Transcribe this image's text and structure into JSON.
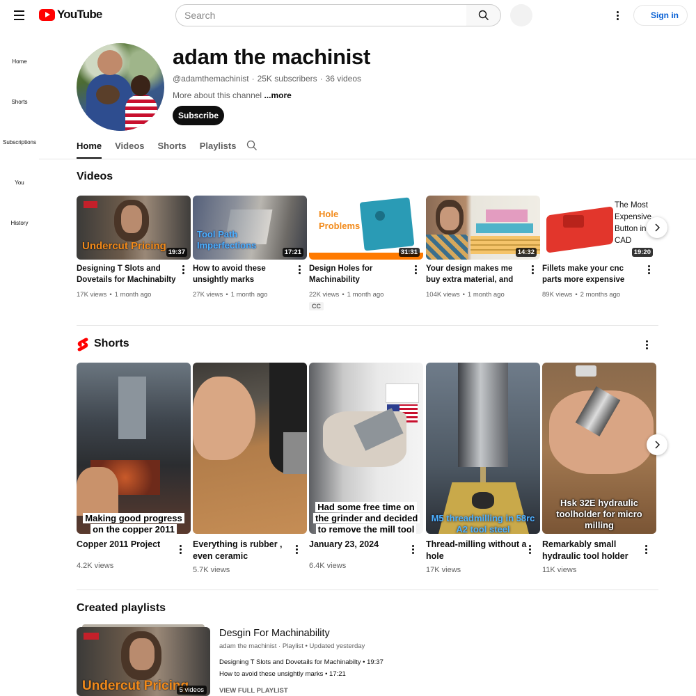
{
  "topbar": {
    "logo_text": "YouTube",
    "search_placeholder": "Search",
    "signin_label": "Sign in"
  },
  "leftnav": [
    "Home",
    "Shorts",
    "Subscriptions",
    "You",
    "History"
  ],
  "channel": {
    "name": "adam the machinist",
    "handle": "@adamthemachinist",
    "subscribers": "25K subscribers",
    "videos_count": "36 videos",
    "about": "More about this channel",
    "more": "...more",
    "subscribe_label": "Subscribe"
  },
  "tabs": [
    "Home",
    "Videos",
    "Shorts",
    "Playlists"
  ],
  "videos_section": {
    "title": "Videos",
    "items": [
      {
        "title": "Designing T Slots and Dovetails for Machinabilty",
        "views": "17K views",
        "age": "1 month ago",
        "duration": "19:37",
        "thumb_text": "Undercut Pricing"
      },
      {
        "title": "How to avoid these unsightly marks",
        "views": "27K views",
        "age": "1 month ago",
        "duration": "17:21",
        "thumb_text": "Tool Path Imperfections"
      },
      {
        "title": "Design Holes for Machinability",
        "views": "22K views",
        "age": "1 month ago",
        "duration": "31:31",
        "thumb_text": "Hole Problems",
        "badge": "CC"
      },
      {
        "title": "Your design makes me buy extra material, and then you...",
        "views": "104K views",
        "age": "1 month ago",
        "duration": "14:32",
        "thumb_text": ""
      },
      {
        "title": "Fillets make your cnc parts more expensive",
        "views": "89K views",
        "age": "2 months ago",
        "duration": "19:20",
        "thumb_text": "The Most Expensive Button in CAD"
      }
    ]
  },
  "shorts_section": {
    "title": "Shorts",
    "items": [
      {
        "title": "Copper 2011 Project",
        "views": "4.2K views",
        "caption": "Making good progress on the copper 2011"
      },
      {
        "title": "Everything is rubber , even ceramic",
        "views": "5.7K views",
        "caption": ""
      },
      {
        "title": "January 23, 2024",
        "views": "6.4K views",
        "caption": "Had some free time on the grinder and decided to remove the mill tool"
      },
      {
        "title": "Thread-milling without a hole",
        "views": "17K views",
        "caption": "M5 threadmilling in 58rc A2 tool steel"
      },
      {
        "title": "Remarkably small hydraulic tool holder",
        "views": "11K views",
        "caption": "Hsk 32E hydraulic toolholder for micro milling"
      }
    ]
  },
  "playlists_section": {
    "title": "Created playlists",
    "playlist": {
      "title": "Desgin For Machinability",
      "owner": "adam the machinist",
      "kind": "Playlist",
      "updated": "Updated yesterday",
      "count": "5 videos",
      "items": [
        {
          "title": "Designing T Slots and Dovetails for Machinabilty",
          "duration": "19:37"
        },
        {
          "title": "How to avoid these unsightly marks",
          "duration": "17:21"
        }
      ],
      "view_full": "VIEW FULL PLAYLIST",
      "thumb_text": "Undercut Pricing"
    }
  },
  "colors": {
    "brand_red": "#ff0000",
    "link_blue": "#065fd4",
    "muted": "#606060"
  }
}
